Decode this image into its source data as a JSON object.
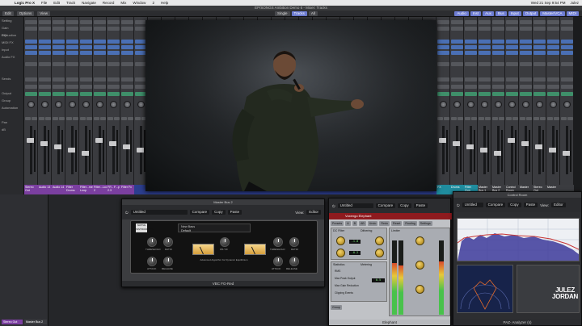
{
  "menubar": {
    "app": "Logic Pro X",
    "items": [
      "File",
      "Edit",
      "Track",
      "Navigate",
      "Record",
      "Mix",
      "Window",
      "2",
      "Help"
    ],
    "clock": "Wed 21 Sep 9:54 PM",
    "user": "Julez"
  },
  "window": {
    "title": "EP/SONGS Ambition Demo 6 - Mixer: Tracks"
  },
  "toolbar": {
    "edit": "Edit",
    "options": "Options",
    "view": "View",
    "center": [
      "Single",
      "Tracks",
      "All"
    ],
    "right": [
      "Audio",
      "Inst",
      "Aux",
      "Bus",
      "Input",
      "Output",
      "Master/VCA",
      "MIDI"
    ]
  },
  "labels": [
    "Setting",
    "Gain Reduction",
    "EQ",
    "MIDI FX",
    "Input",
    "Audio FX",
    "",
    "",
    "Sends",
    "",
    "Output",
    "Group",
    "Automation",
    "",
    "Pan",
    "dB",
    "",
    "",
    "",
    "",
    "",
    "",
    ""
  ],
  "strips": [
    {
      "name": "Stereo Out",
      "color": "#7b3fa0"
    },
    {
      "name": "Audio 13",
      "color": "#7b3fa0"
    },
    {
      "name": "Audio 14",
      "color": "#7b3fa0"
    },
    {
      "name": "Filter Drums",
      "color": "#7b3fa0"
    },
    {
      "name": "Filter...me Loop",
      "color": "#7b3fa0"
    },
    {
      "name": "Filter...Loop 2",
      "color": "#7b3fa0"
    },
    {
      "name": "FR - F...p 2.3",
      "color": "#7b3fa0"
    },
    {
      "name": "Filter Fx",
      "color": "#7b3fa0"
    },
    {
      "name": "",
      "color": "#2c3e8f"
    },
    {
      "name": "",
      "color": "#2c3e8f"
    },
    {
      "name": "",
      "color": "#2c3e8f"
    },
    {
      "name": "",
      "color": "#2c3e8f"
    },
    {
      "name": "",
      "color": "#2c3e8f"
    },
    {
      "name": "",
      "color": "#2c3e8f"
    },
    {
      "name": "",
      "color": "#2c3e8f"
    },
    {
      "name": "",
      "color": "#2c3e8f"
    },
    {
      "name": "",
      "color": "#2c3e8f"
    },
    {
      "name": "",
      "color": "#2c3e8f"
    },
    {
      "name": "",
      "color": "#2c3e8f"
    },
    {
      "name": "",
      "color": "#2c3e8f"
    },
    {
      "name": "",
      "color": "#2c3e8f"
    },
    {
      "name": "",
      "color": "#2c3e8f"
    },
    {
      "name": "",
      "color": "#2c3e8f"
    },
    {
      "name": "",
      "color": "#2c3e8f"
    },
    {
      "name": "",
      "color": "#2c3e8f"
    },
    {
      "name": "",
      "color": "#2c3e8f"
    },
    {
      "name": "",
      "color": "#2c3e8f"
    },
    {
      "name": "",
      "color": "#2c3e8f"
    },
    {
      "name": "",
      "color": "#2c3e8f"
    },
    {
      "name": "",
      "color": "#2c3e8f"
    },
    {
      "name": "FX",
      "color": "#1f8c9e"
    },
    {
      "name": "Drums",
      "color": "#1f8c9e"
    },
    {
      "name": "Filter Gun",
      "color": "#1f8c9e"
    },
    {
      "name": "Master Bus 1",
      "color": "#3b3c40"
    },
    {
      "name": "Master Bus 2",
      "color": "#3b3c40"
    },
    {
      "name": "Control Room",
      "color": "#3b3c40"
    },
    {
      "name": "Master",
      "color": "#3b3c40"
    },
    {
      "name": "Stereo Out",
      "color": "#3b3c40"
    },
    {
      "name": "Master",
      "color": "#3b3c40"
    },
    {
      "name": "",
      "color": "#3b3c40"
    }
  ],
  "lowerleft": {
    "left": "Stereo Out",
    "right": "Master Bus 2"
  },
  "vbc": {
    "window_title": "Master Bus 2",
    "preset": "Untitled",
    "compare": "Compare",
    "copy": "Copy",
    "paste": "Paste",
    "view": "View:",
    "view_value": "Editor",
    "preset_line1": "New Bass",
    "preset_line2": "Default",
    "brand": "NATIVE INSTRUMENTS",
    "knob_labels": [
      "THRESHOLD",
      "RATIO",
      "ATTACK",
      "RELEASE",
      "FB / FF",
      "THRESHOLD",
      "RATIO",
      "ATTACK",
      "RELEASE"
    ],
    "center_label": "Advanced Algorithm for Dynamic Equilibrium",
    "footer": "VBC FG-Red"
  },
  "elephant": {
    "preset": "Untitled",
    "compare": "Compare",
    "copy": "Copy",
    "paste": "Paste",
    "brand": "Voxengo Elephant",
    "rows": [
      "Presets",
      "A",
      "B",
      "AB",
      "Undo",
      "Redo",
      "Reset",
      "Routing",
      "Settings"
    ],
    "sections": [
      "DC Filter",
      "Dithering",
      "Limiter",
      "Statistics",
      "Metering",
      "Group"
    ],
    "lcd": [
      "-1.0",
      "-0.2",
      "0.5"
    ],
    "stats": [
      "RMS",
      "Max Peak Output",
      "Max Gain Reduction",
      "Clipping Events"
    ],
    "footer": "Elephant"
  },
  "paz": {
    "window_title": "Control Room",
    "preset": "Untitled",
    "compare": "Compare",
    "copy": "Copy",
    "paste": "Paste",
    "view": "View:",
    "view_value": "Editor",
    "footer": "PAZ- Analyzer (s)"
  },
  "watermark": "JULEZ JORDAN",
  "colors": {
    "accent": "#6d7cd2",
    "purple": "#7b3fa0",
    "blue": "#2c3e8f",
    "teal": "#1f8c9e"
  }
}
